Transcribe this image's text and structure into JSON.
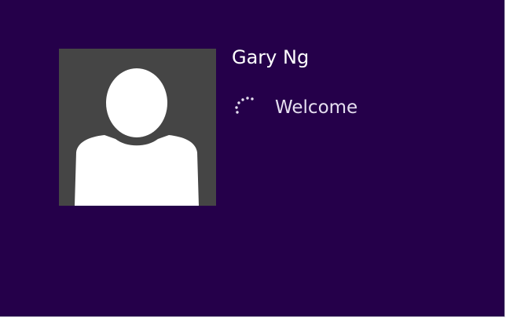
{
  "user": {
    "name": "Gary Ng"
  },
  "status": {
    "text": "Welcome"
  },
  "icons": {
    "avatar": "user-silhouette-icon",
    "spinner": "loading-spinner-icon"
  },
  "colors": {
    "background": "#25004a",
    "avatar_tile": "#454545",
    "silhouette": "#ffffff",
    "text": "#ffffff"
  }
}
